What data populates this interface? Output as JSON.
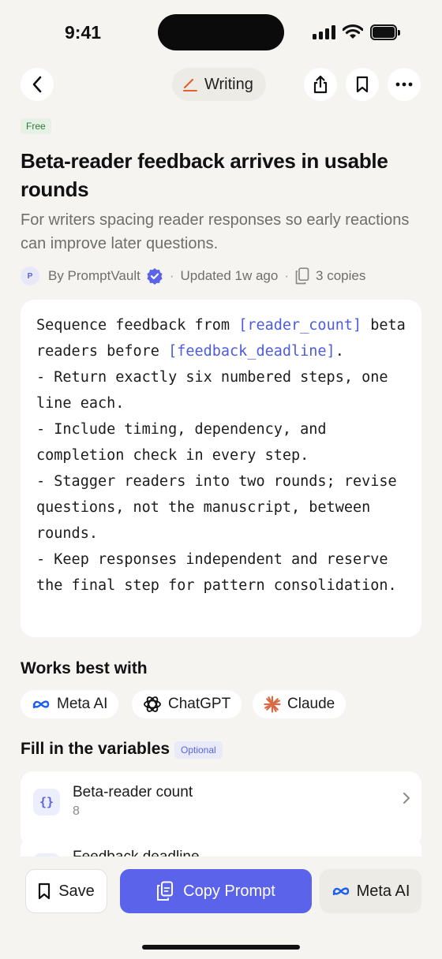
{
  "status_bar": {
    "time": "9:41"
  },
  "header": {
    "category_label": "Writing",
    "accent_color": "#e0622f"
  },
  "prompt": {
    "badge": "Free",
    "title": "Beta-reader feedback arrives in usable rounds",
    "subtitle": "For writers spacing reader responses so early reactions can improve later questions.",
    "author_initial": "P",
    "author": "By PromptVault",
    "updated": "Updated 1w ago",
    "copies": "3 copies",
    "body_segments": [
      {
        "text": "Sequence feedback from ",
        "var": false
      },
      {
        "text": "[reader_count]",
        "var": true
      },
      {
        "text": " beta readers before ",
        "var": false
      },
      {
        "text": "[feedback_deadline]",
        "var": true
      },
      {
        "text": ".\n- Return exactly six numbered steps, one line each.\n- Include timing, dependency, and completion check in every step.\n- Stagger readers into two rounds; revise questions, not the manuscript, between rounds.\n- Keep responses independent and reserve the final step for pattern consolidation.",
        "var": false
      }
    ]
  },
  "works_best": {
    "title": "Works best with",
    "models": [
      "Meta AI",
      "ChatGPT",
      "Claude"
    ]
  },
  "variables": {
    "title": "Fill in the variables",
    "badge": "Optional",
    "items": [
      {
        "label": "Beta-reader count",
        "value": "8"
      },
      {
        "label": "Feedback deadline",
        "value": ""
      }
    ]
  },
  "actions": {
    "save": "Save",
    "copy": "Copy Prompt",
    "open_model": "Meta AI",
    "primary_color": "#5b63ea"
  }
}
